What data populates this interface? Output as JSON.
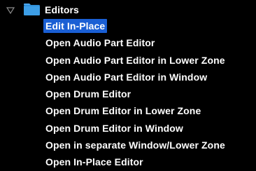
{
  "tree": {
    "folder": {
      "label": "Editors",
      "icon": "folder-icon",
      "expanded": true,
      "folder_color": "#2f8fd8"
    },
    "selection_color": "#1a5fd4",
    "items": [
      {
        "label": "Edit In-Place",
        "selected": true
      },
      {
        "label": "Open Audio Part Editor",
        "selected": false
      },
      {
        "label": "Open Audio Part Editor in Lower Zone",
        "selected": false
      },
      {
        "label": "Open Audio Part Editor in Window",
        "selected": false
      },
      {
        "label": "Open Drum Editor",
        "selected": false
      },
      {
        "label": "Open Drum Editor in Lower Zone",
        "selected": false
      },
      {
        "label": "Open Drum Editor in Window",
        "selected": false
      },
      {
        "label": "Open in separate Window/Lower Zone",
        "selected": false
      },
      {
        "label": "Open In-Place Editor",
        "selected": false
      }
    ]
  }
}
